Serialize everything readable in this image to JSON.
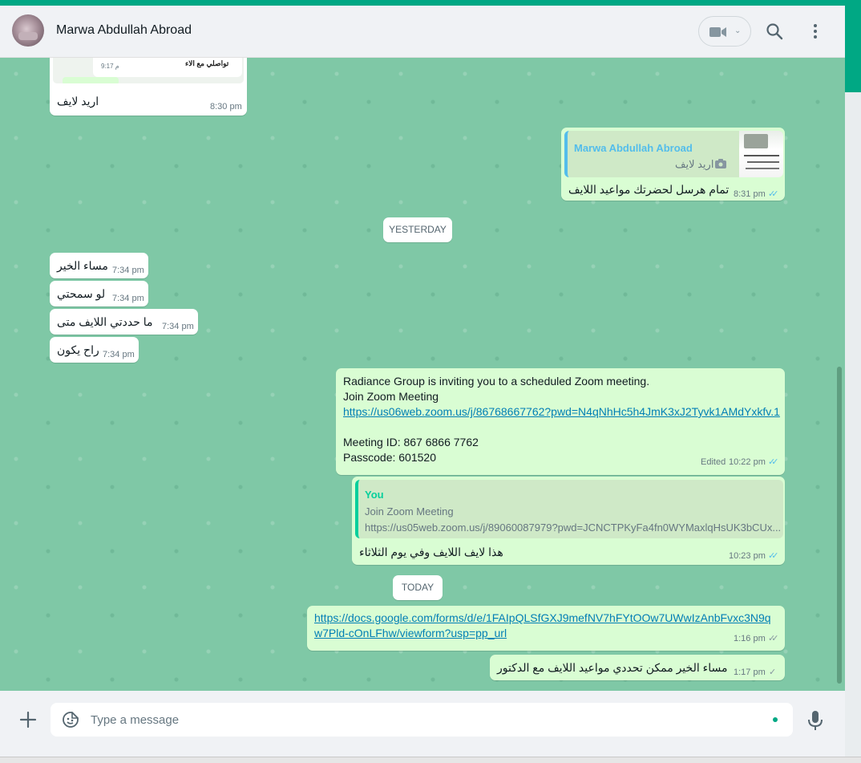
{
  "header": {
    "contact_name": "Marwa Abdullah Abroad",
    "avatar_icon": "contact-avatar",
    "video_icon": "video-camera-icon",
    "search_icon": "search-icon",
    "menu_icon": "kebab-menu-icon"
  },
  "messages": {
    "m1": {
      "text": "اريد لايف",
      "time": "8:30 pm",
      "quoted_preview": "تواصلي مع الاء",
      "quoted_time": "9:17 م"
    },
    "m2": {
      "quote_author": "Marwa Abdullah Abroad",
      "quote_text": "اريد لايف",
      "text": "تمام هرسل لحضرتك مواعيد اللايف",
      "time": "8:31 pm",
      "status": "read"
    },
    "day1": "YESTERDAY",
    "m3": {
      "text": "مساء الخير",
      "time": "7:34 pm"
    },
    "m4": {
      "text": "لو سمحتي",
      "time": "7:34 pm"
    },
    "m5": {
      "text": "ما حددتي اللايف متى",
      "time": "7:34 pm"
    },
    "m6": {
      "text": "راح يكون",
      "time": "7:34 pm"
    },
    "m7": {
      "line1": "Radiance Group is inviting you to a scheduled Zoom meeting.",
      "line2": "Join Zoom Meeting",
      "link": "https://us06web.zoom.us/j/86768667762?pwd=N4qNhHc5h4JmK3xJ2Tyvk1AMdYxkfv.1",
      "line4": "Meeting ID: 867 6866 7762",
      "line5": "Passcode: 601520",
      "edited": "Edited",
      "time": "10:22 pm",
      "status": "read"
    },
    "m8": {
      "quote_author": "You",
      "quote_line1": "Join Zoom Meeting",
      "quote_line2": "https://us05web.zoom.us/j/89060087979?pwd=JCNCTPKyFa4fn0WYMaxlqHsUK3bCUx...",
      "text": "هذا لايف اللايف وفي يوم الثلاثاء",
      "time": "10:23 pm",
      "status": "read"
    },
    "day2": "TODAY",
    "m9": {
      "link_line1": "https://docs.google.com/forms/d/e/1FAIpQLSfGXJ9mefNV7hFYtOOw7UWwIzAnbFvxc3N9q",
      "link_line2": "w7Pld-cOnLFhw/viewform?usp=pp_url",
      "time": "1:16 pm",
      "status": "delivered"
    },
    "m10": {
      "text": "مساء الخير ممكن تحددي مواعيد اللايف مع الدكتور",
      "time": "1:17 pm",
      "status": "sent"
    }
  },
  "ticks": {
    "double": "✓✓",
    "single": "✓"
  },
  "colors": {
    "accent": "#00a884",
    "chat_bg": "#7fc8a6",
    "outgoing": "#d9fdd3",
    "incoming": "#ffffff",
    "read_ticks": "#53bdeb"
  },
  "footer": {
    "placeholder": "Type a message",
    "plus_icon": "plus-icon",
    "emoji_icon": "sticker-smiley-icon",
    "mic_icon": "microphone-icon"
  }
}
